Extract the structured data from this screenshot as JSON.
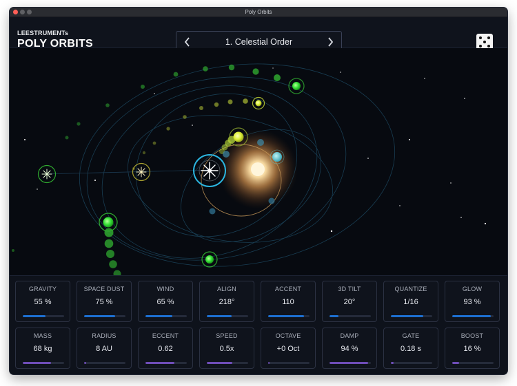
{
  "window": {
    "title": "Poly Orbits"
  },
  "header": {
    "brand": "LEESTRUMENTs",
    "title": "POLY ORBITS",
    "preset": {
      "name": "1. Celestial Order",
      "prev_icon": "chevron-left-icon",
      "next_icon": "chevron-right-icon"
    },
    "randomize_icon": "dice-icon"
  },
  "colors": {
    "background": "#0b0e16",
    "blue_accent": "#1d6fd1",
    "purple_accent": "#6f4db8",
    "sun": "#f4e9c8",
    "planet_green": "#3ee23e",
    "planet_yellow": "#e8f238",
    "moon_teal": "#5fc9d1",
    "orbit_ring": "#2bb6e0"
  },
  "controls": {
    "row1": [
      {
        "label": "GRAVITY",
        "value": "55 %",
        "level": 0.55,
        "color": "#1d6fd1"
      },
      {
        "label": "SPACE DUST",
        "value": "75 %",
        "level": 0.75,
        "color": "#1d6fd1"
      },
      {
        "label": "WIND",
        "value": "65 %",
        "level": 0.65,
        "color": "#1d6fd1"
      },
      {
        "label": "ALIGN",
        "value": "218°",
        "level": 0.6,
        "color": "#1d6fd1"
      },
      {
        "label": "ACCENT",
        "value": "110",
        "level": 0.86,
        "color": "#1d6fd1"
      },
      {
        "label": "3D TILT",
        "value": "20°",
        "level": 0.22,
        "color": "#1d6fd1"
      },
      {
        "label": "QUANTIZE",
        "value": "1/16",
        "level": 0.78,
        "color": "#1d6fd1"
      },
      {
        "label": "GLOW",
        "value": "93 %",
        "level": 0.93,
        "color": "#1d6fd1"
      }
    ],
    "row2": [
      {
        "label": "MASS",
        "value": "68 kg",
        "level": 0.68,
        "color": "#6f4db8"
      },
      {
        "label": "RADIUS",
        "value": "8 AU",
        "level": 0.05,
        "color": "#6f4db8"
      },
      {
        "label": "ECCENT",
        "value": "0.62",
        "level": 0.7,
        "color": "#6f4db8"
      },
      {
        "label": "SPEED",
        "value": "0.5x",
        "level": 0.62,
        "color": "#6f4db8"
      },
      {
        "label": "OCTAVE",
        "value": "+0 Oct",
        "level": 0.03,
        "color": "#6f4db8"
      },
      {
        "label": "DAMP",
        "value": "94 %",
        "level": 0.94,
        "color": "#6f4db8"
      },
      {
        "label": "GATE",
        "value": "0.18 s",
        "level": 0.07,
        "color": "#6f4db8"
      },
      {
        "label": "BOOST",
        "value": "16 %",
        "level": 0.16,
        "color": "#6f4db8"
      }
    ]
  }
}
